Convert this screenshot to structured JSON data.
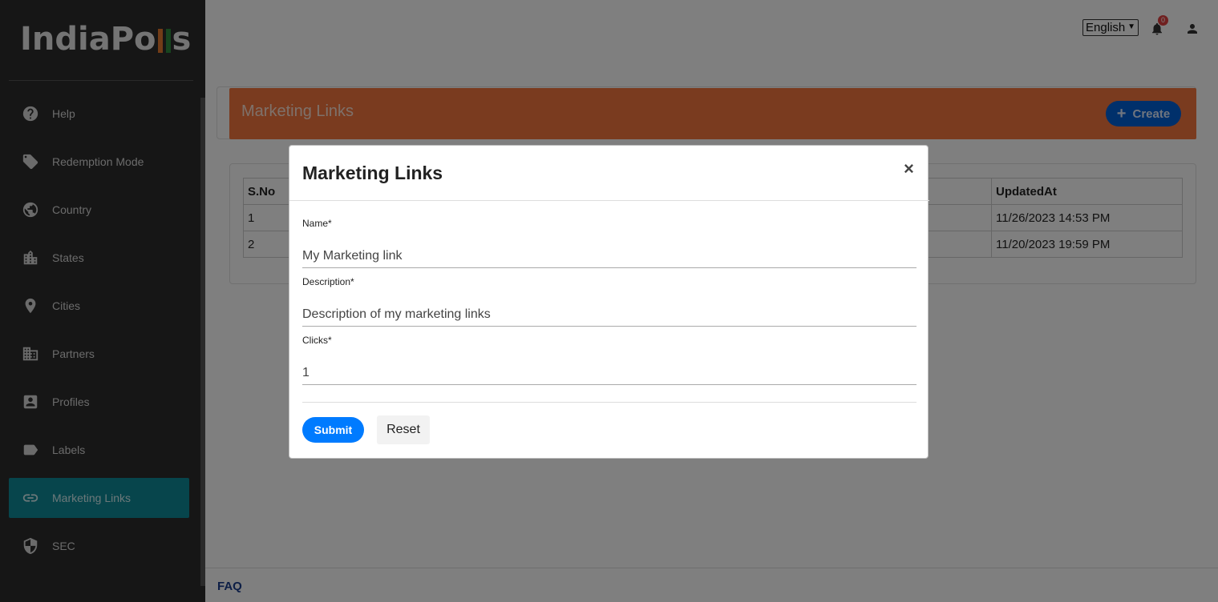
{
  "app": {
    "logo_text_a": "IndiaPo",
    "logo_text_b": "s",
    "logo_bar_colors": [
      "#e5782e",
      "#2e8a3e"
    ]
  },
  "sidebar": {
    "items": [
      {
        "label": "Help",
        "icon": "help-circle-icon"
      },
      {
        "label": "Redemption Mode",
        "icon": "tag-icon"
      },
      {
        "label": "Country",
        "icon": "globe-icon"
      },
      {
        "label": "States",
        "icon": "city-icon"
      },
      {
        "label": "Cities",
        "icon": "location-pin-icon"
      },
      {
        "label": "Partners",
        "icon": "building-icon"
      },
      {
        "label": "Profiles",
        "icon": "account-box-icon"
      },
      {
        "label": "Labels",
        "icon": "label-icon"
      },
      {
        "label": "Marketing Links",
        "icon": "link-icon",
        "active": true
      },
      {
        "label": "SEC",
        "icon": "shield-icon"
      }
    ]
  },
  "topbar": {
    "language": "English",
    "notification_count": "0"
  },
  "page": {
    "title": "Marketing Links",
    "create_label": "Create"
  },
  "table": {
    "headers": {
      "sno": "S.No",
      "updated_at": "UpdatedAt"
    },
    "rows": [
      {
        "sno": "1",
        "updated_at": "11/26/2023 14:53 PM"
      },
      {
        "sno": "2",
        "updated_at": "11/20/2023 19:59 PM"
      }
    ]
  },
  "footer": {
    "link": "FAQ"
  },
  "modal": {
    "title": "Marketing Links",
    "close": "×",
    "fields": {
      "name_label": "Name*",
      "name_value": "My Marketing link",
      "description_label": "Description*",
      "description_value": "Description of my marketing links",
      "clicks_label": "Clicks*",
      "clicks_value": "1"
    },
    "submit_label": "Submit",
    "reset_label": "Reset"
  },
  "colors": {
    "sidebar_bg": "#2c2c2c",
    "active_item": "#0f8a99",
    "header_band": "#f4763f",
    "create_button": "#0060d6",
    "submit_button": "#007bff"
  }
}
